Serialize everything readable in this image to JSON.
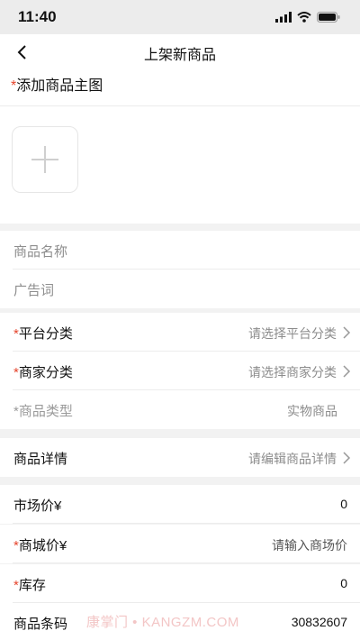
{
  "status_bar": {
    "time": "11:40"
  },
  "nav": {
    "title": "上架新商品"
  },
  "image_section": {
    "required_mark": "*",
    "label": "添加商品主图"
  },
  "basic_info": {
    "name_placeholder": "商品名称",
    "ad_placeholder": "广告词"
  },
  "category": {
    "platform": {
      "required_mark": "*",
      "label": "平台分类",
      "value": "请选择平台分类"
    },
    "merchant": {
      "required_mark": "*",
      "label": "商家分类",
      "value": "请选择商家分类"
    },
    "type": {
      "required_mark": "*",
      "label": "商品类型",
      "value": "实物商品"
    }
  },
  "details": {
    "label": "商品详情",
    "value": "请编辑商品详情"
  },
  "pricing": {
    "market_price": {
      "label": "市场价¥",
      "value": "0"
    },
    "mall_price": {
      "required_mark": "*",
      "label": "商城价¥",
      "placeholder": "请输入商场价"
    },
    "stock": {
      "required_mark": "*",
      "label": "库存",
      "value": "0"
    },
    "barcode": {
      "label": "商品条码",
      "value": "30832607"
    }
  },
  "watermark": "康掌门 • KANGZM.COM",
  "colors": {
    "required": "#e5452d",
    "background": "#f2f2f2"
  }
}
